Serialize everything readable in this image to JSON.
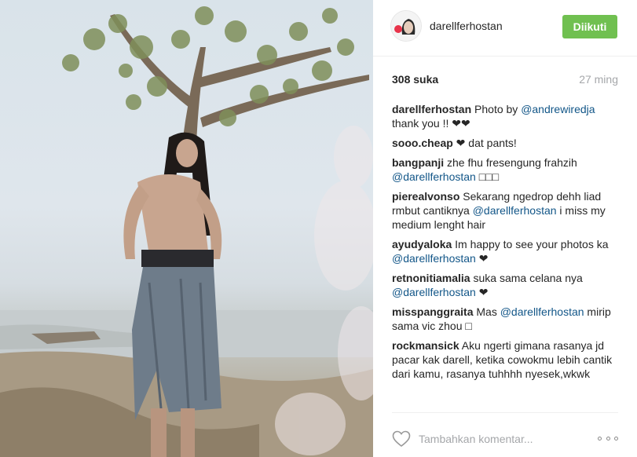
{
  "post": {
    "photo_icon": "photo-of-man-under-tree-at-beach"
  },
  "header": {
    "username": "darellferhostan",
    "follow_label": "Diikuti",
    "follow_color": "#70c050"
  },
  "stats": {
    "likes": "308 suka",
    "age": "27 ming"
  },
  "comments": [
    {
      "author": "darellferhostan",
      "parts": [
        " Photo by ",
        "@andrewiredja",
        " thank you !! ❤❤"
      ]
    },
    {
      "author": "sooo.cheap",
      "parts": [
        " ❤ dat pants!"
      ]
    },
    {
      "author": "bangpanji",
      "parts": [
        " zhe fhu fresengung frahzih ",
        "@darellferhostan",
        " □□□"
      ]
    },
    {
      "author": "pierealvonso",
      "parts": [
        " Sekarang ngedrop dehh liad rmbut cantiknya ",
        "@darellferhostan",
        " i miss my medium lenght hair"
      ]
    },
    {
      "author": "ayudyaloka",
      "parts": [
        " Im happy to see your photos ka ",
        "@darellferhostan",
        " ❤"
      ]
    },
    {
      "author": "retnonitiamalia",
      "parts": [
        " suka sama celana nya ",
        "@darellferhostan",
        " ❤"
      ]
    },
    {
      "author": "misspanggraita",
      "parts": [
        " Mas ",
        "@darellferhostan",
        " mirip sama vic zhou □"
      ]
    },
    {
      "author": "rockmansick",
      "parts": [
        " Aku ngerti gimana rasanya jd pacar kak darell, ketika cowokmu lebih cantik dari kamu, rasanya tuhhhh nyesek,wkwk"
      ]
    }
  ],
  "footer": {
    "comment_placeholder": "Tambahkan komentar...",
    "like_icon": "heart-outline-icon",
    "more_icon": "more-options-icon"
  },
  "colors": {
    "mention": "#125688",
    "muted": "#a5a7aa",
    "text": "#262626"
  }
}
